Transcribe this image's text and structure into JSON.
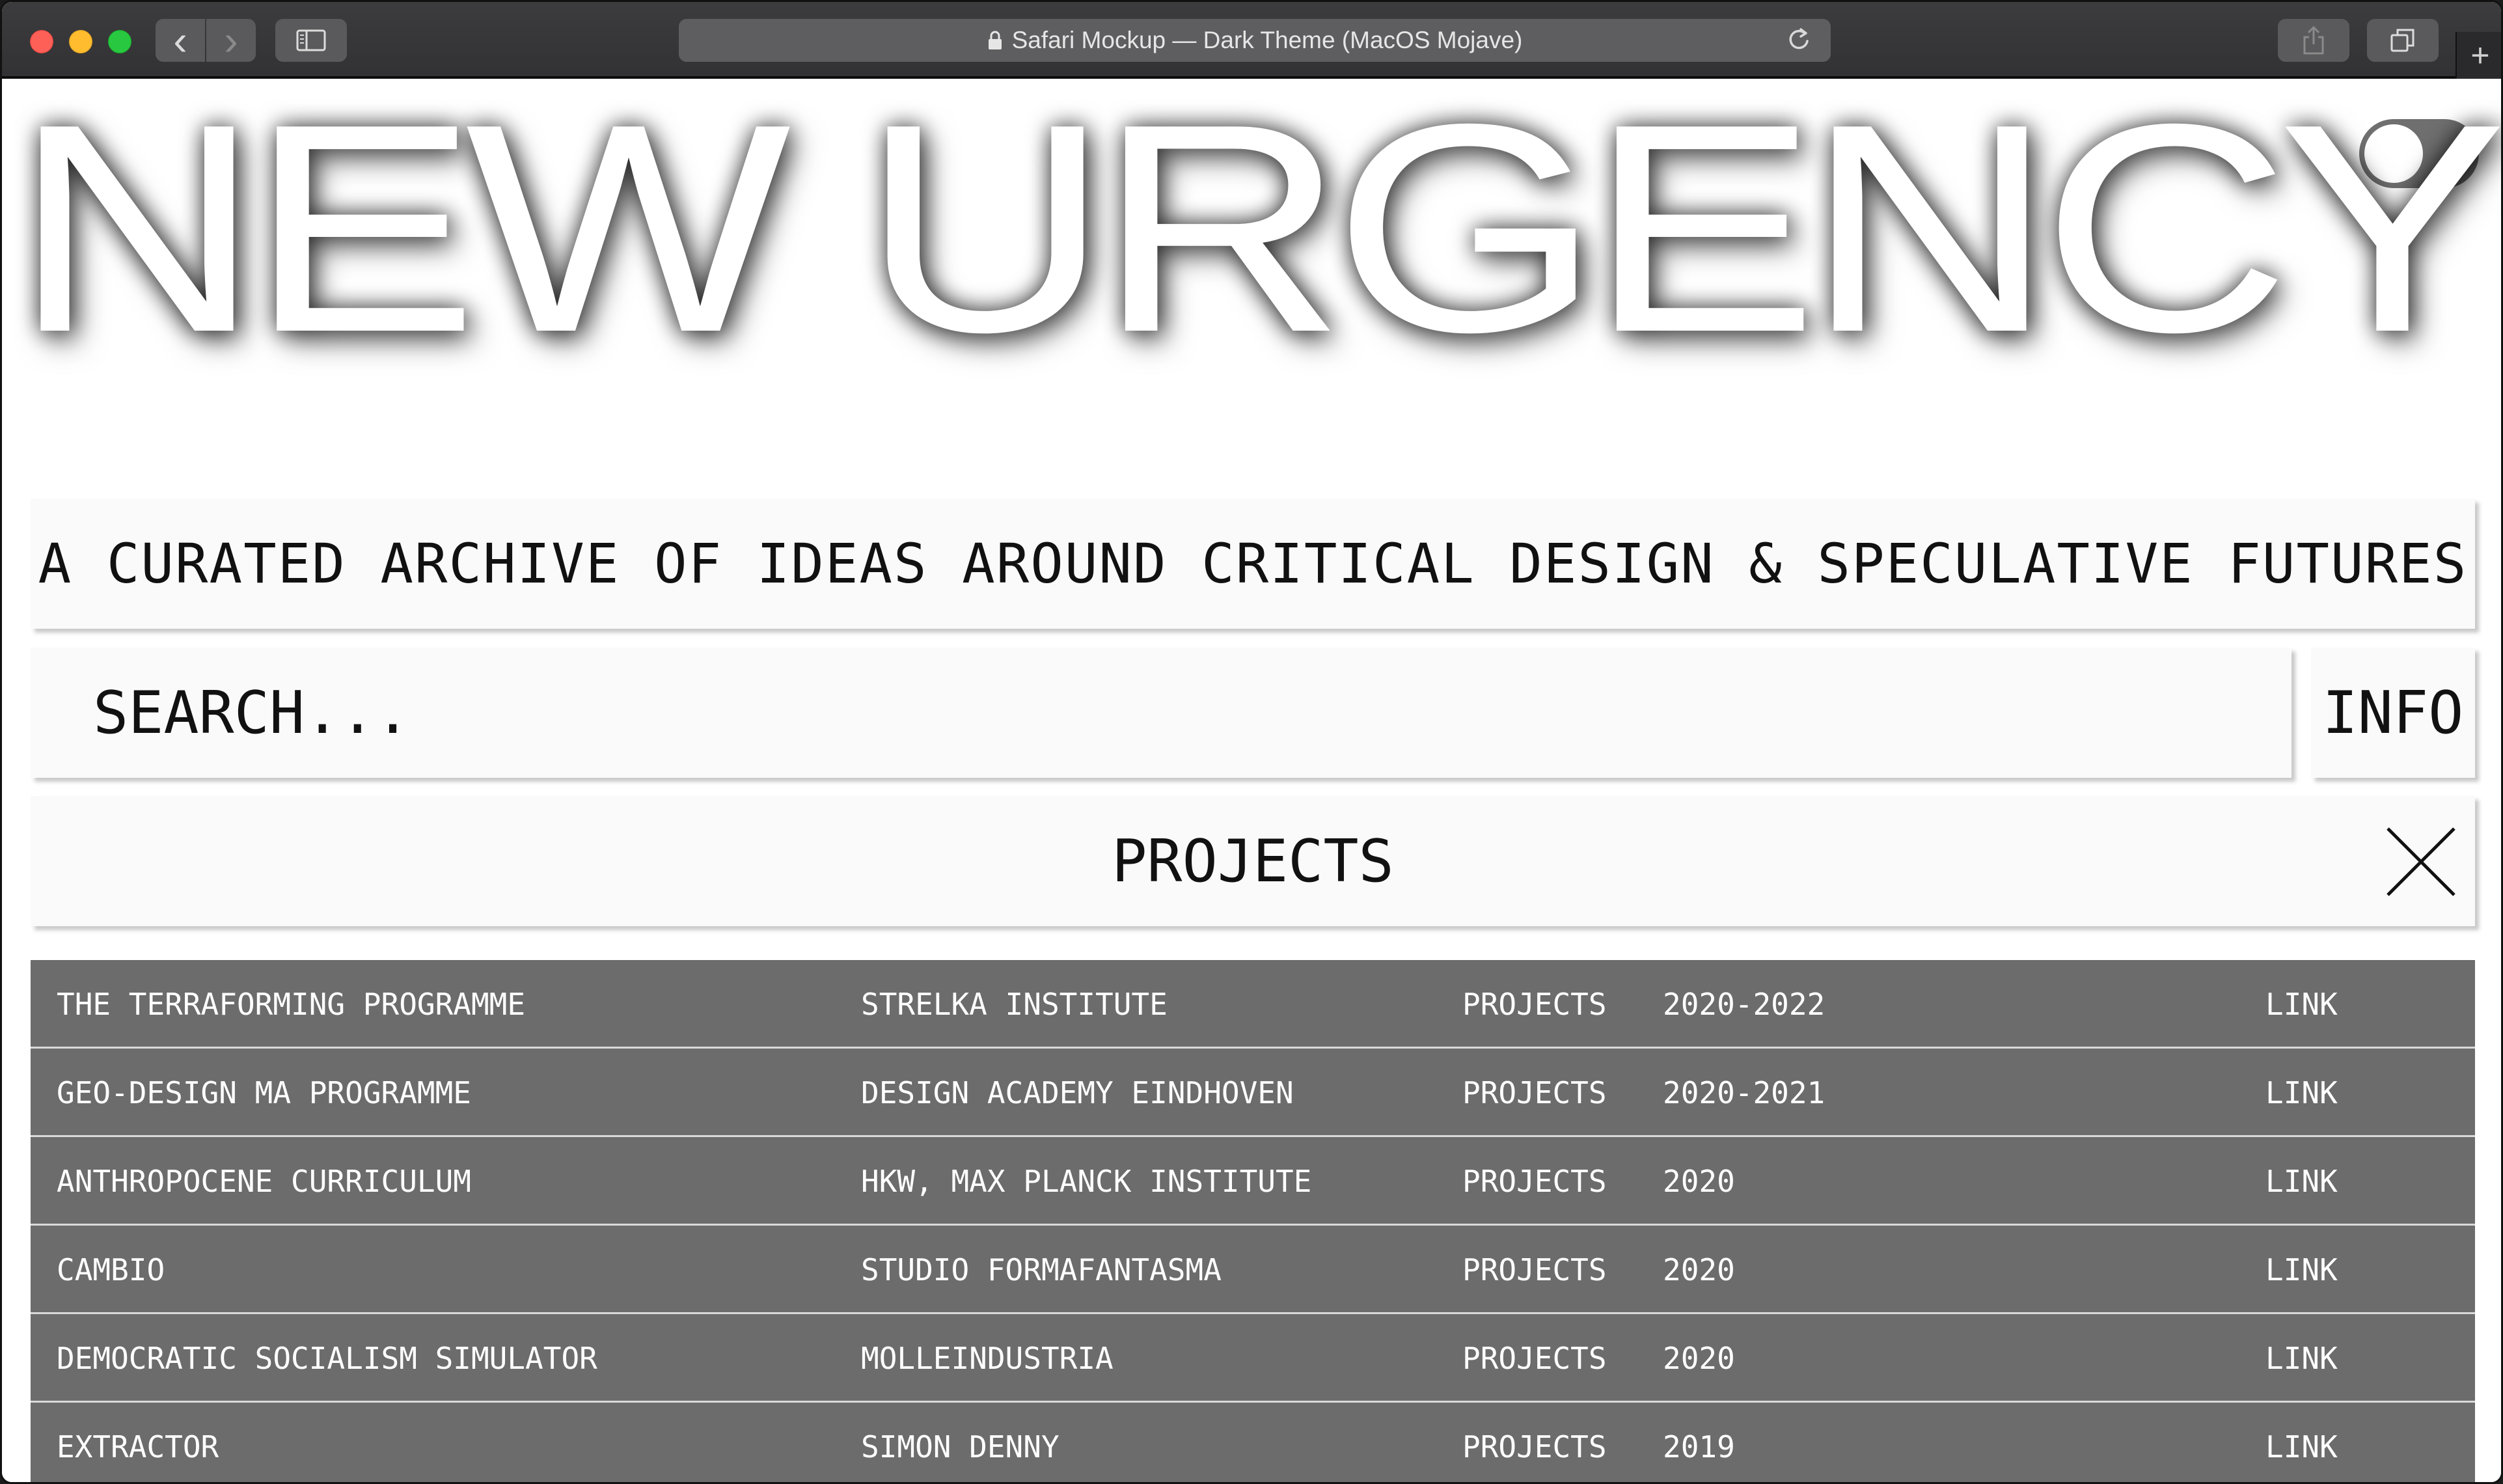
{
  "browser": {
    "address_text": "Safari Mockup — Dark Theme (MacOS Mojave)",
    "back_icon": "‹",
    "forward_icon": "›",
    "new_tab_icon": "+"
  },
  "hero": {
    "title": "NEW URGENCY"
  },
  "tagline": "A CURATED ARCHIVE OF IDEAS AROUND CRITICAL DESIGN & SPECULATIVE FUTURES",
  "search": {
    "placeholder": "SEARCH..."
  },
  "info_label": "INFO",
  "section": {
    "title": "PROJECTS"
  },
  "rows": [
    {
      "title": "THE TERRAFORMING PROGRAMME",
      "author": "STRELKA INSTITUTE",
      "category": "PROJECTS",
      "year": "2020-2022",
      "link": "LINK"
    },
    {
      "title": "GEO-DESIGN MA PROGRAMME",
      "author": "DESIGN ACADEMY EINDHOVEN",
      "category": "PROJECTS",
      "year": "2020-2021",
      "link": "LINK"
    },
    {
      "title": "ANTHROPOCENE CURRICULUM",
      "author": "HKW, MAX PLANCK INSTITUTE",
      "category": "PROJECTS",
      "year": "2020",
      "link": "LINK"
    },
    {
      "title": "CAMBIO",
      "author": "STUDIO FORMAFANTASMA",
      "category": "PROJECTS",
      "year": "2020",
      "link": "LINK"
    },
    {
      "title": "DEMOCRATIC SOCIALISM SIMULATOR",
      "author": "MOLLEINDUSTRIA",
      "category": "PROJECTS",
      "year": "2020",
      "link": "LINK"
    },
    {
      "title": "EXTRACTOR",
      "author": "SIMON DENNY",
      "category": "PROJECTS",
      "year": "2019",
      "link": "LINK"
    }
  ],
  "colors": {
    "row_bg": "#6c6c6c",
    "card_bg": "#fafafa",
    "toggle_track": "#6f6f6f"
  }
}
